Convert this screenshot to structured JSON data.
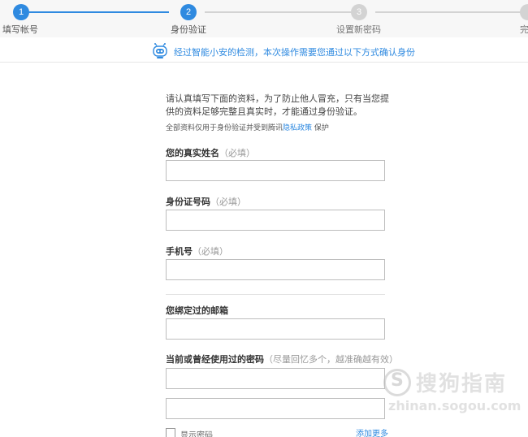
{
  "stepper": {
    "steps": [
      {
        "number": "1",
        "label": "填写帐号",
        "state": "done"
      },
      {
        "number": "2",
        "label": "身份验证",
        "state": "current"
      },
      {
        "number": "3",
        "label": "设置新密码",
        "state": "pending"
      },
      {
        "number": "",
        "label": "完",
        "state": "pending"
      }
    ],
    "colors": {
      "active": "#2f8ae0",
      "inactive": "#d3d3d3"
    }
  },
  "notice": {
    "icon": "robot-icon",
    "text": "经过智能小安的检测，本次操作需要您通过以下方式确认身份"
  },
  "form": {
    "intro": "请认真填写下面的资料，为了防止他人冒充，只有当您提供的资料足够完整且真实时，才能通过身份验证。",
    "privacy_prefix": "全部资料仅用于身份验证并受到腾讯",
    "privacy_link": "隐私政策",
    "privacy_suffix": "保护",
    "fields": {
      "real_name": {
        "label": "您的真实姓名",
        "hint": "（必填）",
        "value": ""
      },
      "id_number": {
        "label": "身份证号码",
        "hint": "（必填）",
        "value": ""
      },
      "phone": {
        "label": "手机号",
        "hint": "（必填）",
        "value": ""
      },
      "email": {
        "label": "您绑定过的邮箱",
        "hint": "",
        "value": ""
      },
      "password": {
        "label": "当前或曾经使用过的密码",
        "hint": "（尽量回忆多个，越准确越有效）",
        "value1": "",
        "value2": ""
      }
    },
    "show_password_label": "显示密码",
    "add_more_label": "添加更多"
  },
  "watermark": {
    "text": "搜狗指南",
    "url": "zhinan.sogou.com"
  }
}
